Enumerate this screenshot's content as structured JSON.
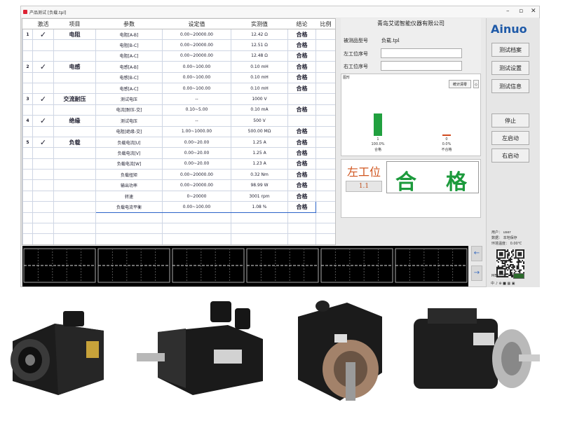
{
  "window": {
    "title": "产品测试 [负载.tpl]",
    "controls": [
      "–",
      "▫",
      "✕"
    ]
  },
  "table": {
    "headers": [
      "激活",
      "项目",
      "参数",
      "设定值",
      "实测值",
      "结论",
      "比例"
    ],
    "rows": [
      {
        "idx": "1",
        "active": true,
        "item": "电阻",
        "param": "电阻[A-B]",
        "set": "0.00~20000.00",
        "meas": "12.42 Ω",
        "verdict": "合格"
      },
      {
        "idx": "",
        "active": false,
        "item": "",
        "param": "电阻[B-C]",
        "set": "0.00~20000.00",
        "meas": "12.51 Ω",
        "verdict": "合格"
      },
      {
        "idx": "",
        "active": false,
        "item": "",
        "param": "电阻[A-C]",
        "set": "0.00~20000.00",
        "meas": "12.48 Ω",
        "verdict": "合格"
      },
      {
        "idx": "2",
        "active": true,
        "item": "电感",
        "param": "电感[A-B]",
        "set": "0.00~100.00",
        "meas": "0.10 mH",
        "verdict": "合格"
      },
      {
        "idx": "",
        "active": false,
        "item": "",
        "param": "电感[B-C]",
        "set": "0.00~100.00",
        "meas": "0.10 mH",
        "verdict": "合格"
      },
      {
        "idx": "",
        "active": false,
        "item": "",
        "param": "电感[A-C]",
        "set": "0.00~100.00",
        "meas": "0.10 mH",
        "verdict": "合格"
      },
      {
        "idx": "3",
        "active": true,
        "item": "交流耐压",
        "param": "测试电压",
        "set": "--",
        "meas": "1000 V",
        "verdict": ""
      },
      {
        "idx": "",
        "active": false,
        "item": "",
        "param": "电流[耐压-交]",
        "set": "0.10~5.00",
        "meas": "0.10 mA",
        "verdict": "合格"
      },
      {
        "idx": "4",
        "active": true,
        "item": "绝缘",
        "param": "测试电压",
        "set": "--",
        "meas": "500 V",
        "verdict": ""
      },
      {
        "idx": "",
        "active": false,
        "item": "",
        "param": "电阻[绝缘-交]",
        "set": "1.00~1000.00",
        "meas": "500.00 MΩ",
        "verdict": "合格"
      },
      {
        "idx": "5",
        "active": true,
        "item": "负载",
        "param": "负载电流[U]",
        "set": "0.00~20.00",
        "meas": "1.25 A",
        "verdict": "合格"
      },
      {
        "idx": "",
        "active": false,
        "item": "",
        "param": "负载电流[V]",
        "set": "0.00~20.00",
        "meas": "1.25 A",
        "verdict": "合格"
      },
      {
        "idx": "",
        "active": false,
        "item": "",
        "param": "负载电流[W]",
        "set": "0.00~20.00",
        "meas": "1.23 A",
        "verdict": "合格"
      },
      {
        "idx": "",
        "active": false,
        "item": "",
        "param": "负载扭矩",
        "set": "0.00~20000.00",
        "meas": "0.32 Nm",
        "verdict": "合格"
      },
      {
        "idx": "",
        "active": false,
        "item": "",
        "param": "输出功率",
        "set": "0.00~20000.00",
        "meas": "98.99 W",
        "verdict": "合格"
      },
      {
        "idx": "",
        "active": false,
        "item": "",
        "param": "转速",
        "set": "0~20000",
        "meas": "3001 rpm",
        "verdict": "合格"
      },
      {
        "idx": "",
        "active": false,
        "item": "",
        "param": "负载电流平衡",
        "set": "0.00~100.00",
        "meas": "1.08 %",
        "verdict": "合格"
      },
      {
        "idx": "",
        "active": false,
        "item": "",
        "param": "",
        "set": "",
        "meas": "",
        "verdict": ""
      },
      {
        "idx": "",
        "active": false,
        "item": "",
        "param": "",
        "set": "",
        "meas": "",
        "verdict": ""
      },
      {
        "idx": "",
        "active": false,
        "item": "",
        "param": "",
        "set": "",
        "meas": "",
        "verdict": ""
      },
      {
        "idx": "",
        "active": false,
        "item": "",
        "param": "",
        "set": "",
        "meas": "",
        "verdict": ""
      }
    ]
  },
  "info": {
    "company": "青岛艾诺智能仪器有限公司",
    "model_label": "被测品型号",
    "model_value": "负载.tpl",
    "left_serial_label": "左工位序号",
    "right_serial_label": "右工位序号"
  },
  "chart_panel": {
    "tab_label": "图形",
    "clear_button": "统计清零",
    "scroll_glyph": "◇",
    "pass_stat": {
      "count": "1",
      "percent": "100.0%",
      "label": "合格",
      "fraction": 1.0,
      "color": "#21a03f"
    },
    "fail_stat": {
      "count": "0",
      "percent": "0.0%",
      "label": "不合格",
      "fraction": 0.0,
      "color": "#d04a1e"
    }
  },
  "status": {
    "station_label": "左工位",
    "station_number": "1.1",
    "result_chars": [
      "合",
      "格"
    ]
  },
  "sidebar": {
    "logo": "Ainuo",
    "buttons": [
      "测试档案",
      "测试设置",
      "测试信息"
    ],
    "control_buttons": [
      "停止",
      "左启动",
      "右启动"
    ],
    "user_line": "用户： user",
    "db_line": "数据： 本地保存",
    "temp_line": "环境温度： 0.00℃",
    "mes_label": "MES同步：",
    "lang_label": "中 ♪ ⊕ ■ ▦ ▣"
  },
  "scope": {
    "segments": 6,
    "left_arrow": "←",
    "right_arrow": "→"
  },
  "colors": {
    "accent": "#1f5aa8",
    "pass": "#1c9a3c",
    "station": "#d0551e"
  }
}
